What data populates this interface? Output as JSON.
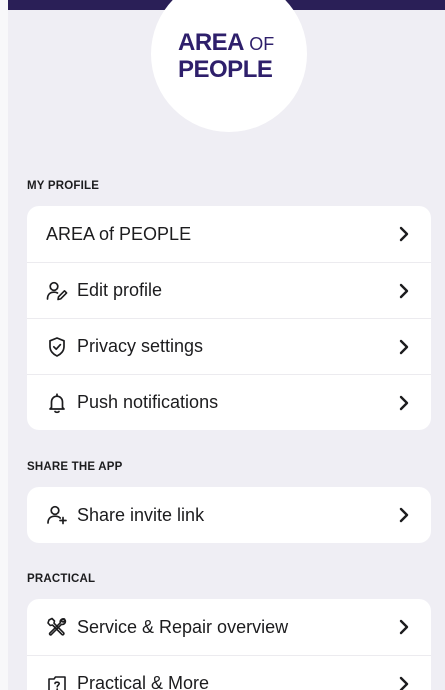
{
  "logo": {
    "line1_main": "AREA",
    "line1_small": "OF",
    "line2": "PEOPLE"
  },
  "sections": {
    "profile": {
      "title": "MY PROFILE",
      "items": [
        {
          "label": "AREA of PEOPLE",
          "icon": "none"
        },
        {
          "label": "Edit profile",
          "icon": "edit-user-icon"
        },
        {
          "label": "Privacy settings",
          "icon": "shield-check-icon"
        },
        {
          "label": "Push notifications",
          "icon": "bell-icon"
        }
      ]
    },
    "share": {
      "title": "SHARE THE APP",
      "items": [
        {
          "label": "Share invite link",
          "icon": "add-user-icon"
        }
      ]
    },
    "practical": {
      "title": "PRACTICAL",
      "items": [
        {
          "label": "Service & Repair overview",
          "icon": "tools-icon"
        },
        {
          "label": "Practical & More",
          "icon": "question-box-icon"
        }
      ]
    }
  },
  "colors": {
    "top_bar": "#2a1f57",
    "logo_text": "#2e1f6b",
    "background": "#efeef4",
    "card": "#ffffff"
  }
}
